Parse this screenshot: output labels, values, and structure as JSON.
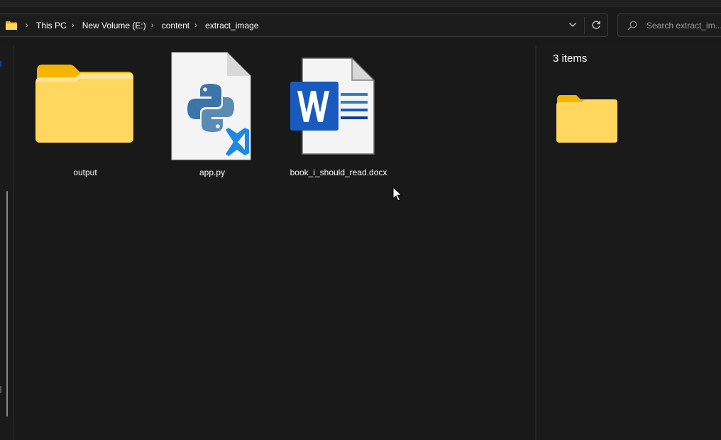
{
  "address_bar": {
    "breadcrumbs": [
      "This PC",
      "New Volume (E:)",
      "content",
      "extract_image"
    ]
  },
  "search": {
    "placeholder": "Search extract_im..."
  },
  "files": [
    {
      "name": "output",
      "icon": "folder-icon"
    },
    {
      "name": "app.py",
      "icon": "python-file-icon"
    },
    {
      "name": "book_i_should_read.docx",
      "icon": "word-document-icon"
    }
  ],
  "details": {
    "item_count": "3 items"
  },
  "colors": {
    "folder_yellow": "#FFD75E",
    "folder_tab": "#F4B400",
    "word_blue": "#185ABD",
    "python_blue": "#3A74A8",
    "vscode_blue": "#1E88E5"
  }
}
